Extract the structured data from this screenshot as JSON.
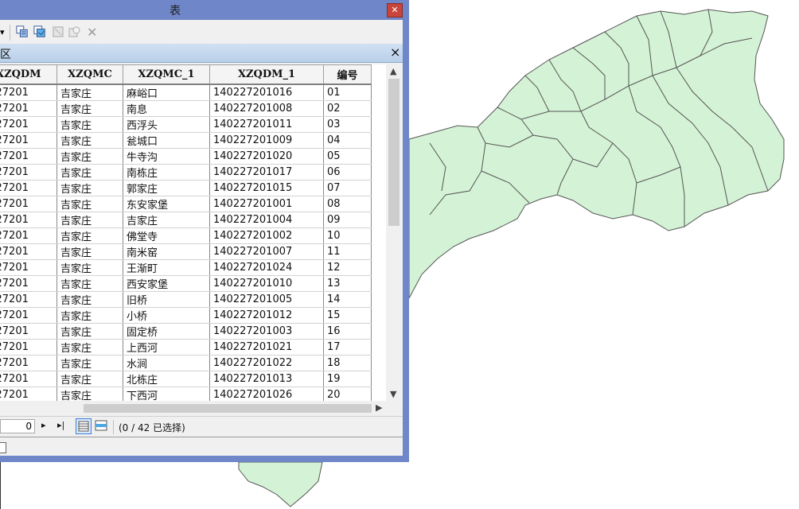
{
  "window": {
    "title": "表",
    "close_glyph": "✕"
  },
  "toolbar": {
    "dropdown_glyph": "▾",
    "icons": [
      "table-options-icon",
      "related-tables-icon",
      "clear-selection-icon",
      "zoom-to-selected-icon",
      "delete-selected-icon"
    ]
  },
  "table_tab": {
    "label": "区",
    "close_glyph": "×"
  },
  "grid": {
    "columns": [
      "XZQDM",
      "XZQMC",
      "XZQMC_1",
      "XZQDM_1",
      "编号"
    ],
    "rows": [
      [
        "27201",
        "吉家庄",
        "麻峪口",
        "140227201016",
        "01"
      ],
      [
        "27201",
        "吉家庄",
        "南息",
        "140227201008",
        "02"
      ],
      [
        "27201",
        "吉家庄",
        "西浮头",
        "140227201011",
        "03"
      ],
      [
        "27201",
        "吉家庄",
        "瓮城口",
        "140227201009",
        "04"
      ],
      [
        "27201",
        "吉家庄",
        "牛寺沟",
        "140227201020",
        "05"
      ],
      [
        "27201",
        "吉家庄",
        "南栋庄",
        "140227201017",
        "06"
      ],
      [
        "27201",
        "吉家庄",
        "郭家庄",
        "140227201015",
        "07"
      ],
      [
        "27201",
        "吉家庄",
        "东安家堡",
        "140227201001",
        "08"
      ],
      [
        "27201",
        "吉家庄",
        "吉家庄",
        "140227201004",
        "09"
      ],
      [
        "27201",
        "吉家庄",
        "佛堂寺",
        "140227201002",
        "10"
      ],
      [
        "27201",
        "吉家庄",
        "南米窑",
        "140227201007",
        "11"
      ],
      [
        "27201",
        "吉家庄",
        "王渐町",
        "140227201024",
        "12"
      ],
      [
        "27201",
        "吉家庄",
        "西安家堡",
        "140227201010",
        "13"
      ],
      [
        "27201",
        "吉家庄",
        "旧桥",
        "140227201005",
        "14"
      ],
      [
        "27201",
        "吉家庄",
        "小桥",
        "140227201012",
        "15"
      ],
      [
        "27201",
        "吉家庄",
        "固定桥",
        "140227201003",
        "16"
      ],
      [
        "27201",
        "吉家庄",
        "上西河",
        "140227201021",
        "17"
      ],
      [
        "27201",
        "吉家庄",
        "水涧",
        "140227201022",
        "18"
      ],
      [
        "27201",
        "吉家庄",
        "北栋庄",
        "140227201013",
        "19"
      ],
      [
        "27201",
        "吉家庄",
        "下西河",
        "140227201026",
        "20"
      ]
    ]
  },
  "navigation": {
    "current_record": "0",
    "next_glyph": "▸",
    "last_glyph": "▸|",
    "selection_status": "(0 / 42 已选择)"
  },
  "map": {
    "fill_color": "#d4f2d6",
    "stroke_color": "#555555"
  }
}
